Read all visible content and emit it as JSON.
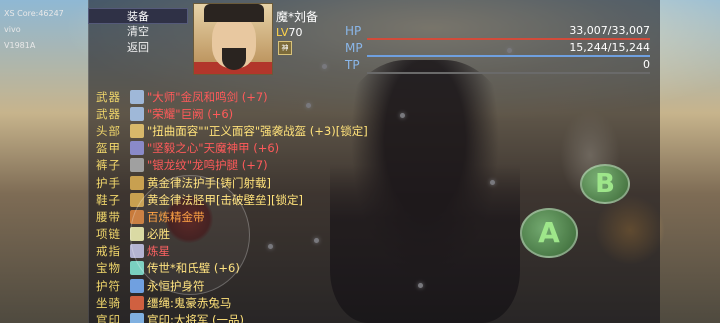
{
  "debug": {
    "line1": "XS Core:46247",
    "line2": "vivo",
    "line3": "V1981A"
  },
  "menu": {
    "items": [
      {
        "label": "装备",
        "active": true
      },
      {
        "label": "清空",
        "active": false
      },
      {
        "label": "返回",
        "active": false
      }
    ]
  },
  "hero": {
    "name": "魔*刘备",
    "lv_prefix": "LV",
    "level": "70",
    "badge": "神"
  },
  "stats": {
    "hp_label": "HP",
    "hp_value": "33,007/33,007",
    "mp_label": "MP",
    "mp_value": "15,244/15,244",
    "tp_label": "TP",
    "tp_value": "0"
  },
  "equipment": [
    {
      "slot": "武器",
      "item": "\"大师\"金凤和鸣剑 (+7)",
      "color": "c-red",
      "icon": "sword-icon"
    },
    {
      "slot": "武器",
      "item": "\"荣耀\"巨阙 (+6)",
      "color": "c-red",
      "icon": "sword-icon"
    },
    {
      "slot": "头部",
      "item": "\"扭曲面容\"\"正义面容\"强袭战盔 (+3)[锁定]",
      "color": "c-yellow",
      "icon": "helmet-icon"
    },
    {
      "slot": "盔甲",
      "item": "\"坚毅之心\"天魔神甲 (+6)",
      "color": "c-red",
      "icon": "armor-icon"
    },
    {
      "slot": "裤子",
      "item": "\"银龙纹\"龙鸣护腿 (+7)",
      "color": "c-red",
      "icon": "pants-icon"
    },
    {
      "slot": "护手",
      "item": "黄金律法护手[铸门射载]",
      "color": "c-yellow",
      "icon": "glove-icon"
    },
    {
      "slot": "鞋子",
      "item": "黄金律法胫甲[击破壁垒][锁定]",
      "color": "c-yellow",
      "icon": "boot-icon"
    },
    {
      "slot": "腰带",
      "item": "百炼精金带",
      "color": "c-orange",
      "icon": "belt-icon"
    },
    {
      "slot": "项链",
      "item": "必胜",
      "color": "c-yellow",
      "icon": "necklace-icon"
    },
    {
      "slot": "戒指",
      "item": "炼星",
      "color": "c-red",
      "icon": "ring-icon"
    },
    {
      "slot": "宝物",
      "item": "传世*和氏璧 (+6)",
      "color": "c-yellow",
      "icon": "treasure-icon"
    },
    {
      "slot": "护符",
      "item": "永恒护身符",
      "color": "c-yellow",
      "icon": "amulet-icon"
    },
    {
      "slot": "坐骑",
      "item": "缰绳:鬼豪赤兔马",
      "color": "c-yellow",
      "icon": "mount-icon"
    },
    {
      "slot": "官印",
      "item": "官印:大将军 (一品)",
      "color": "c-yellow",
      "icon": "seal-icon"
    }
  ],
  "buttons": {
    "a": "A",
    "b": "B"
  }
}
